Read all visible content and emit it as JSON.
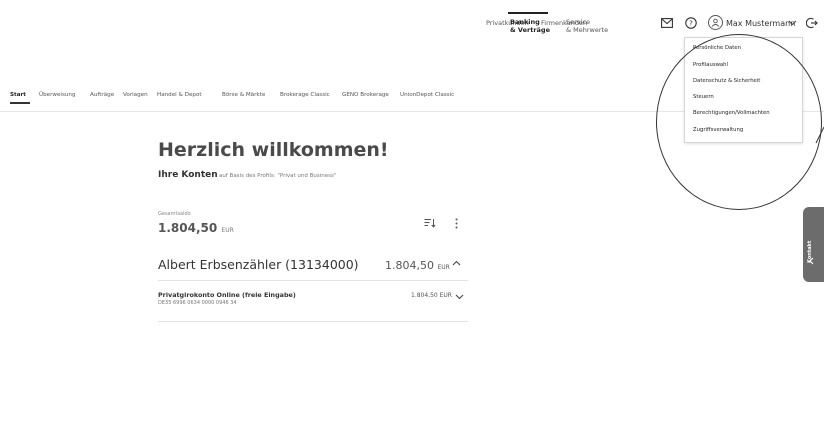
{
  "top_nav": {
    "items": [
      {
        "label": "Privatkunden"
      },
      {
        "label": "Firmenkunden"
      },
      {
        "label_line1": "Banking",
        "label_line2": "& Verträge",
        "active": true
      },
      {
        "label_line1": "Service",
        "label_line2": "& Mehrwerte"
      }
    ]
  },
  "header": {
    "icons": [
      "mail-icon",
      "help-icon",
      "user-avatar-icon",
      "chevron-down-icon",
      "logout-icon"
    ],
    "user_name": "Max Mustermann"
  },
  "user_menu": {
    "items": [
      "Persönliche Daten",
      "Profilauswahl",
      "Datenschutz & Sicherheit",
      "Steuern",
      "Berechtigungen/Vollmachten",
      "Zugriffsverwaltung"
    ]
  },
  "sub_nav": {
    "items": [
      "Start",
      "Überweisung",
      "Aufträge",
      "Vorlagen",
      "Handel & Depot",
      "Börse & Märkte",
      "Brokerage Classic",
      "GENO Brokerage",
      "UnionDepot Classic"
    ],
    "active_index": 0
  },
  "main": {
    "welcome": "Herzlich willkommen!",
    "konten_title": "Ihre Konten",
    "konten_subtitle": "auf Basis des Profils: \"Privat und Business\"",
    "saldo_label": "Gesamtsaldo",
    "saldo_value": "1.804,50",
    "saldo_currency": "EUR",
    "account_group": {
      "name": "Albert Erbsenzähler (13134000)",
      "amount": "1.804,50",
      "currency": "EUR"
    },
    "accounts": [
      {
        "title": "Privatgirokonto Online (freie Eingabe)",
        "iban": "DE35 6996 0634 0000 0946 34",
        "amount": "1.804,50 EUR"
      }
    ]
  },
  "kontakt_tab": {
    "label": "Kontakt"
  },
  "colors": {
    "accent": "#222222",
    "tab_bg": "#6c6c6c",
    "separator": "#e4e4e4"
  }
}
